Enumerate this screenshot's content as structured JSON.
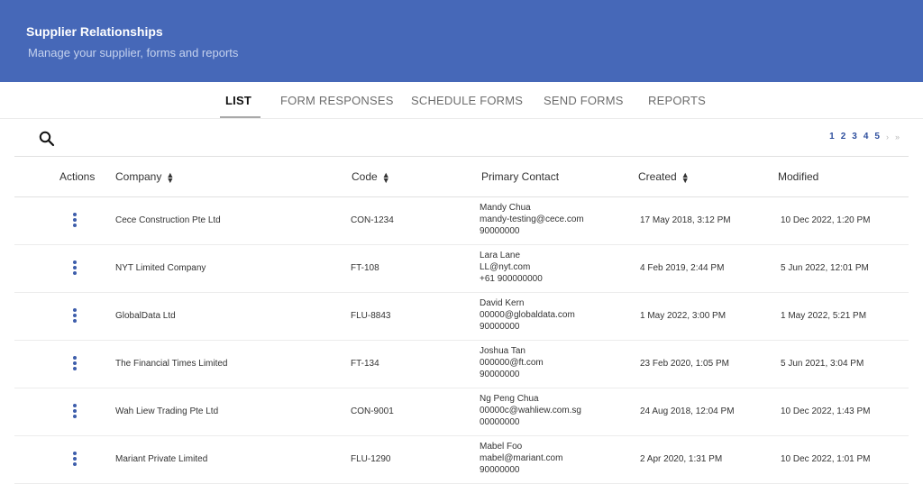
{
  "header": {
    "title": "Supplier Relationships",
    "subtitle": "Manage your supplier, forms and reports"
  },
  "tabs": [
    {
      "label": "LIST",
      "active": true
    },
    {
      "label": "FORM RESPONSES"
    },
    {
      "label": "SCHEDULE FORMS"
    },
    {
      "label": "SEND FORMS"
    },
    {
      "label": "REPORTS"
    }
  ],
  "pagination": {
    "pages": [
      "1",
      "2",
      "3",
      "4",
      "5"
    ],
    "next": "›",
    "last": "»"
  },
  "columns": {
    "actions": "Actions",
    "company": "Company",
    "code": "Code",
    "contact": "Primary Contact",
    "created": "Created",
    "modified": "Modified"
  },
  "rows": [
    {
      "company": "Cece Construction Pte Ltd",
      "code": "CON-1234",
      "contact_name": "Mandy Chua",
      "contact_email": "mandy-testing@cece.com",
      "contact_phone": "90000000",
      "created": "17 May 2018, 3:12 PM",
      "modified": "10 Dec 2022, 1:20 PM"
    },
    {
      "company": "NYT Limited Company",
      "code": "FT-108",
      "contact_name": "Lara Lane",
      "contact_email": "LL@nyt.com",
      "contact_phone": "+61 900000000",
      "created": "4 Feb 2019, 2:44 PM",
      "modified": "5 Jun 2022, 12:01 PM"
    },
    {
      "company": "GlobalData Ltd",
      "code": "FLU-8843",
      "contact_name": "David Kern",
      "contact_email": "00000@globaldata.com",
      "contact_phone": "90000000",
      "created": "1 May 2022, 3:00 PM",
      "modified": "1 May 2022, 5:21 PM"
    },
    {
      "company": "The Financial Times Limited",
      "code": "FT-134",
      "contact_name": "Joshua Tan",
      "contact_email": "000000@ft.com",
      "contact_phone": "90000000",
      "created": "23 Feb 2020, 1:05 PM",
      "modified": "5 Jun 2021, 3:04 PM"
    },
    {
      "company": "Wah Liew Trading Pte Ltd",
      "code": "CON-9001",
      "contact_name": "Ng Peng Chua",
      "contact_email": "00000c@wahliew.com.sg",
      "contact_phone": "00000000",
      "created": "24 Aug 2018, 12:04 PM",
      "modified": "10 Dec 2022, 1:43 PM"
    },
    {
      "company": "Mariant Private Limited",
      "code": "FLU-1290",
      "contact_name": "Mabel Foo",
      "contact_email": "mabel@mariant.com",
      "contact_phone": "90000000",
      "created": "2 Apr 2020, 1:31 PM",
      "modified": "10 Dec 2022, 1:01 PM"
    }
  ]
}
